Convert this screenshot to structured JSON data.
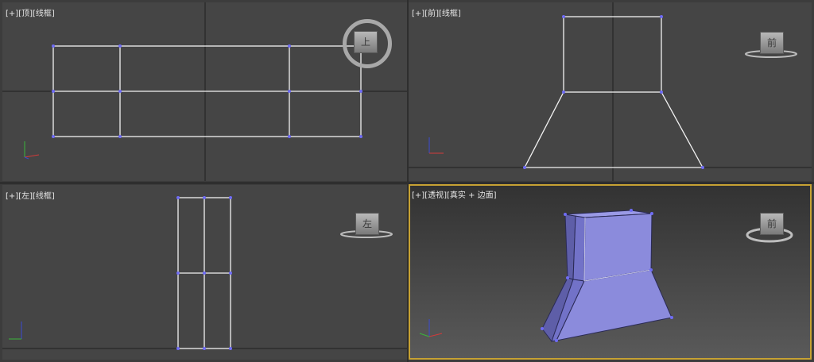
{
  "viewports": {
    "top": {
      "plus": "[+]",
      "name": "[顶]",
      "mode": "[线框]",
      "cube_label": "上"
    },
    "front": {
      "plus": "[+]",
      "name": "[前]",
      "mode": "[线框]",
      "cube_label": "前"
    },
    "left": {
      "plus": "[+]",
      "name": "[左]",
      "mode": "[线框]",
      "cube_label": "左"
    },
    "perspective": {
      "plus": "[+]",
      "name": "[透视]",
      "mode": "[真实 + 边面]",
      "cube_label": "前"
    }
  },
  "colors": {
    "viewport_bg": "#454545",
    "wire": "#f2f2f2",
    "vertex": "#6f6cf5",
    "mesh_fill": "#8b8bdc",
    "active_border": "#c7a233"
  },
  "icons": [
    "viewcube-icon",
    "axis-tripod-icon"
  ]
}
